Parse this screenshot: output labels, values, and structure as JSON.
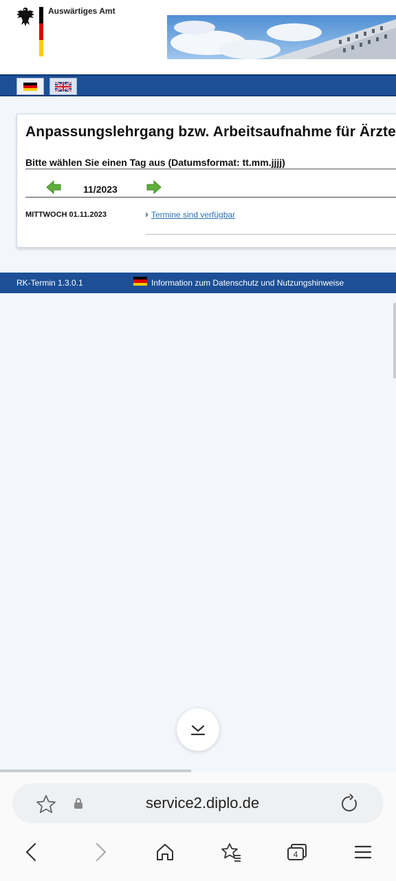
{
  "header": {
    "brand": "Auswärtiges Amt",
    "flag_colors": [
      "#000000",
      "#dd0000",
      "#ffcc00"
    ]
  },
  "languages": [
    {
      "code": "de",
      "icon": "german-flag-icon"
    },
    {
      "code": "en",
      "icon": "uk-flag-icon"
    }
  ],
  "content": {
    "title": "Anpassungslehrgang bzw. Arbeitsaufnahme für Ärzte",
    "subtitle": "Bitte wählen Sie einen Tag aus (Datumsformat: tt.mm.jjjj)",
    "month": "11/2023",
    "day_label": "MITTWOCH 01.11.2023",
    "slot_link": "Termine sind verfügbar"
  },
  "footer": {
    "version": "RK-Termin 1.3.0.1",
    "privacy": "Information zum Datenschutz und Nutzungshinweise"
  },
  "browser": {
    "url": "service2.diplo.de",
    "tab_count": "4"
  },
  "colors": {
    "accent_blue": "#1c4f96",
    "link": "#2a6fb3",
    "nav_arrow_green": "#5fae3a"
  }
}
